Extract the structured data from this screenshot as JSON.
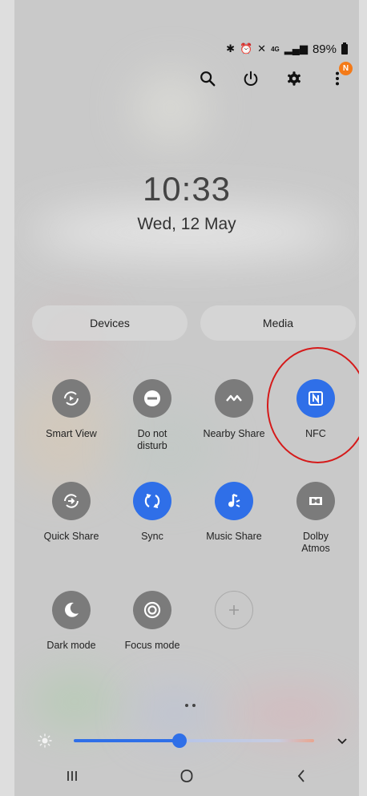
{
  "status": {
    "battery": "89%",
    "network": "4G"
  },
  "actions": {
    "notif_badge": "N"
  },
  "lock": {
    "time": "10:33",
    "date": "Wed, 12 May"
  },
  "pills": {
    "devices": "Devices",
    "media": "Media"
  },
  "tiles": [
    {
      "label": "Smart View",
      "state": "off",
      "icon": "smart-view-icon"
    },
    {
      "label": "Do not\ndisturb",
      "state": "off",
      "icon": "do-not-disturb-icon"
    },
    {
      "label": "Nearby Share",
      "state": "off",
      "icon": "nearby-share-icon"
    },
    {
      "label": "NFC",
      "state": "on",
      "icon": "nfc-icon"
    },
    {
      "label": "Quick Share",
      "state": "off",
      "icon": "quick-share-icon"
    },
    {
      "label": "Sync",
      "state": "on",
      "icon": "sync-icon"
    },
    {
      "label": "Music Share",
      "state": "on",
      "icon": "music-share-icon"
    },
    {
      "label": "Dolby\nAtmos",
      "state": "off",
      "icon": "dolby-atmos-icon"
    },
    {
      "label": "Dark mode",
      "state": "off",
      "icon": "dark-mode-icon"
    },
    {
      "label": "Focus mode",
      "state": "off",
      "icon": "focus-mode-icon"
    },
    {
      "label": "",
      "state": "add",
      "icon": "add-icon"
    }
  ],
  "brightness": {
    "level": 0.44
  },
  "colors": {
    "accent": "#2f6fe8",
    "tile_off": "#7b7b7b",
    "badge": "#f47a18",
    "highlight_ring": "#d51a1a"
  }
}
